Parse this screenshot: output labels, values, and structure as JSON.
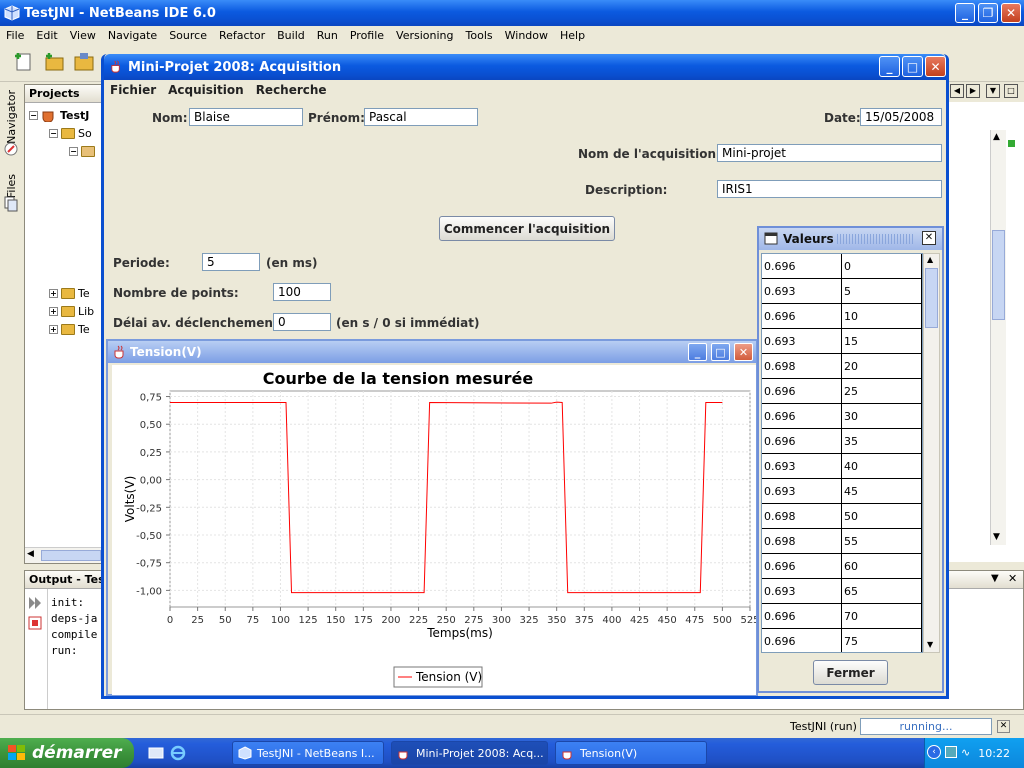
{
  "netbeans": {
    "title": "TestJNI - NetBeans IDE 6.0",
    "menu": [
      "File",
      "Edit",
      "View",
      "Navigate",
      "Source",
      "Refactor",
      "Build",
      "Run",
      "Profile",
      "Versioning",
      "Tools",
      "Window",
      "Help"
    ],
    "side_tabs": [
      "Navigator",
      "Files"
    ],
    "projects_header": "Projects",
    "tree": [
      "TestJ",
      "So",
      "Te",
      "Lib",
      "Te"
    ],
    "output_header": "Output - Tes",
    "output_lines": [
      "init:",
      "deps-ja",
      "compile",
      "run:"
    ],
    "status_project": "TestJNI (run)",
    "status_progress": "running..."
  },
  "main_window": {
    "title": "Mini-Projet 2008: Acquisition",
    "menu": [
      "Fichier",
      "Acquisition",
      "Recherche"
    ],
    "nom_label": "Nom:",
    "nom_value": "Blaise",
    "prenom_label": "Prénom:",
    "prenom_value": "Pascal",
    "date_label": "Date:",
    "date_value": "15/05/2008",
    "acq_name_label": "Nom de l'acquisition:",
    "acq_name_value": "Mini-projet",
    "description_label": "Description:",
    "description_value": "IRIS1",
    "start_button": "Commencer l'acquisition",
    "periode_label": "Periode:",
    "periode_value": "5",
    "periode_unit": "(en ms)",
    "points_label": "Nombre de points:",
    "points_value": "100",
    "delai_label": "Délai av. déclenchement:",
    "delai_value": "0",
    "delai_unit": "(en s / 0 si immédiat)"
  },
  "tension_window": {
    "title": "Tension(V)"
  },
  "chart_data": {
    "type": "line",
    "title": "Courbe de la tension mesurée",
    "xlabel": "Temps(ms)",
    "ylabel": "Volts(V)",
    "xlim": [
      0,
      525
    ],
    "ylim": [
      -1.15,
      0.8
    ],
    "xticks": [
      "0",
      "25",
      "50",
      "75",
      "100",
      "125",
      "150",
      "175",
      "200",
      "225",
      "250",
      "275",
      "300",
      "325",
      "350",
      "375",
      "400",
      "425",
      "450",
      "475",
      "500",
      "525"
    ],
    "yticks": [
      "0,75",
      "0,50",
      "0,25",
      "0,00",
      "-0,25",
      "-0,50",
      "-0,75",
      "-1,00"
    ],
    "ytick_values": [
      0.75,
      0.5,
      0.25,
      0.0,
      -0.25,
      -0.5,
      -0.75,
      -1.0
    ],
    "grid": true,
    "legend": "bottom",
    "series": [
      {
        "name": "Tension (V)",
        "color": "#FF0000",
        "x": [
          0,
          105,
          110,
          175,
          230,
          235,
          345,
          350,
          355,
          360,
          480,
          485,
          500
        ],
        "y": [
          0.696,
          0.696,
          -1.02,
          -1.02,
          -1.02,
          0.696,
          0.69,
          0.7,
          0.696,
          -1.02,
          -1.02,
          0.696,
          0.696
        ]
      }
    ]
  },
  "valeurs_window": {
    "title": "Valeurs",
    "rows": [
      [
        "0.696",
        "0"
      ],
      [
        "0.693",
        "5"
      ],
      [
        "0.696",
        "10"
      ],
      [
        "0.693",
        "15"
      ],
      [
        "0.698",
        "20"
      ],
      [
        "0.696",
        "25"
      ],
      [
        "0.696",
        "30"
      ],
      [
        "0.696",
        "35"
      ],
      [
        "0.693",
        "40"
      ],
      [
        "0.693",
        "45"
      ],
      [
        "0.698",
        "50"
      ],
      [
        "0.698",
        "55"
      ],
      [
        "0.696",
        "60"
      ],
      [
        "0.693",
        "65"
      ],
      [
        "0.696",
        "70"
      ],
      [
        "0.696",
        "75"
      ]
    ],
    "close_button": "Fermer"
  },
  "taskbar": {
    "start": "démarrer",
    "tasks": [
      "TestJNI - NetBeans I...",
      "Mini-Projet 2008: Acq...",
      "Tension(V)"
    ],
    "clock": "10:22"
  }
}
